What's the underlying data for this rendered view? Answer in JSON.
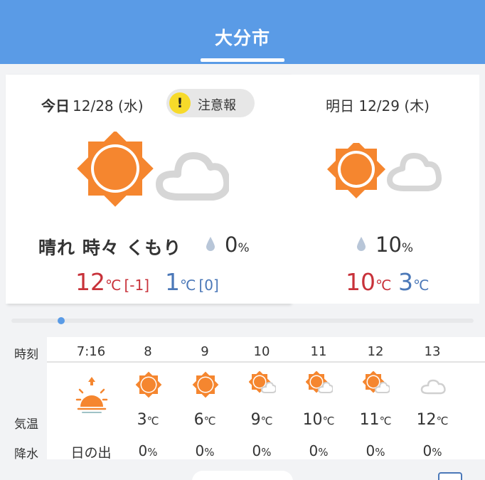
{
  "header": {
    "city": "大分市"
  },
  "today": {
    "label": "今日",
    "date": "12/28",
    "weekday": "(水)",
    "alert": {
      "symbol": "!",
      "text": "注意報"
    },
    "icon": "sun-with-cloud-icon",
    "weather": "晴れ 時々 くもり",
    "precip": "0",
    "precip_unit": "%",
    "high": "12",
    "high_diff": "[-1]",
    "low": "1",
    "low_diff": "[0]",
    "temp_unit": "℃"
  },
  "tomorrow": {
    "label": "明日",
    "date": "12/29",
    "weekday": "(木)",
    "icon": "sun-with-cloud-icon",
    "precip": "10",
    "precip_unit": "%",
    "high": "10",
    "low": "3",
    "temp_unit": "℃"
  },
  "hourly": {
    "labels": {
      "time": "時刻",
      "temp": "気温",
      "precip": "降水"
    },
    "columns": [
      {
        "time": "7:16",
        "icon": "sunrise-icon",
        "temp": "",
        "precip": "日の出"
      },
      {
        "time": "8",
        "icon": "sun-icon",
        "temp": "3",
        "precip": "0"
      },
      {
        "time": "9",
        "icon": "sun-icon",
        "temp": "6",
        "precip": "0"
      },
      {
        "time": "10",
        "icon": "sun-cloud-icon",
        "temp": "9",
        "precip": "0"
      },
      {
        "time": "11",
        "icon": "sun-cloud-icon",
        "temp": "10",
        "precip": "0"
      },
      {
        "time": "12",
        "icon": "sun-cloud-icon",
        "temp": "11",
        "precip": "0"
      },
      {
        "time": "13",
        "icon": "cloud-icon",
        "temp": "12",
        "precip": "0"
      }
    ],
    "temp_unit": "℃",
    "precip_unit": "%"
  },
  "colors": {
    "header": "#5a9be6",
    "sun": "#f5862f",
    "cloud": "#e3e3e3",
    "high": "#c8323a",
    "low": "#4b78b8",
    "alert": "#f7da2a"
  }
}
